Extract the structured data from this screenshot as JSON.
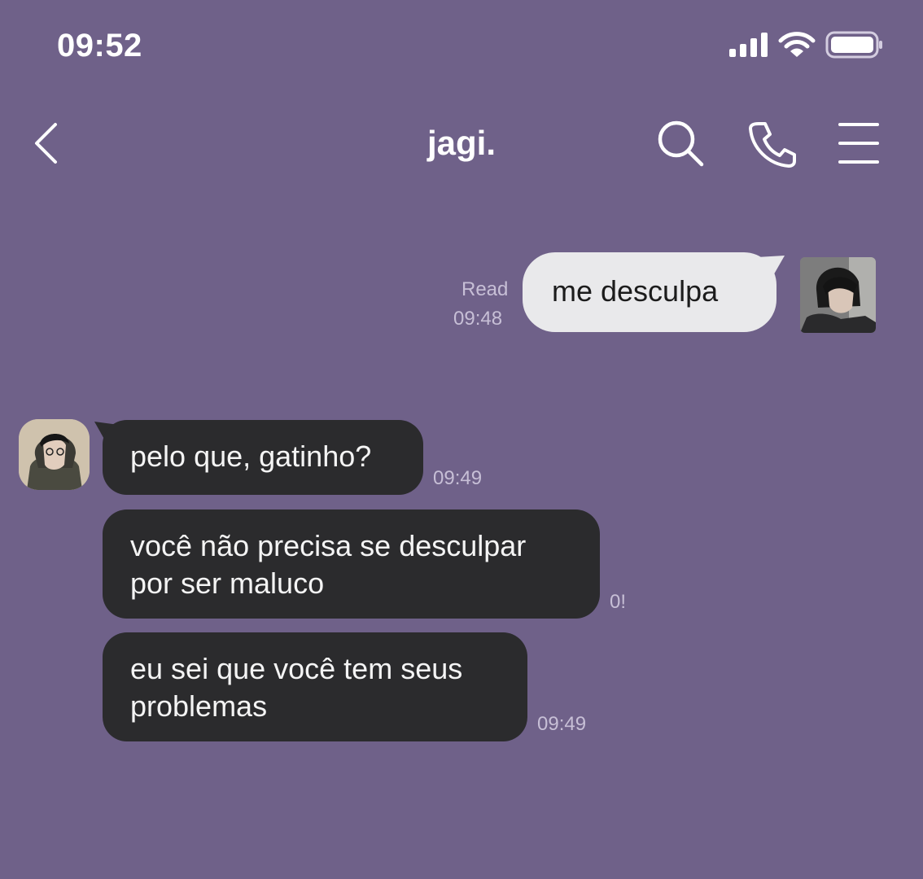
{
  "status_bar": {
    "time": "09:52",
    "icons": [
      "cellular-signal-icon",
      "wifi-icon",
      "battery-icon"
    ]
  },
  "header": {
    "title": "jagi.",
    "icons": [
      "back-chevron-icon",
      "search-icon",
      "phone-icon",
      "menu-icon"
    ]
  },
  "messages": [
    {
      "direction": "outgoing",
      "text": "me desculpa",
      "read_label": "Read",
      "time": "09:48"
    },
    {
      "direction": "incoming",
      "text": "pelo que, gatinho?",
      "time": "09:49"
    },
    {
      "direction": "incoming",
      "lines": [
        "você não precisa se desculpar",
        "por ser maluco"
      ],
      "time": "0!"
    },
    {
      "direction": "incoming",
      "lines": [
        "eu sei que você tem seus",
        "problemas"
      ],
      "time": "09:49"
    }
  ],
  "colors": {
    "background": "#6f6189",
    "outgoing_bubble": "#e9e9eb",
    "incoming_bubble": "#2b2b2d",
    "timestamp": "#c7bfd6"
  }
}
